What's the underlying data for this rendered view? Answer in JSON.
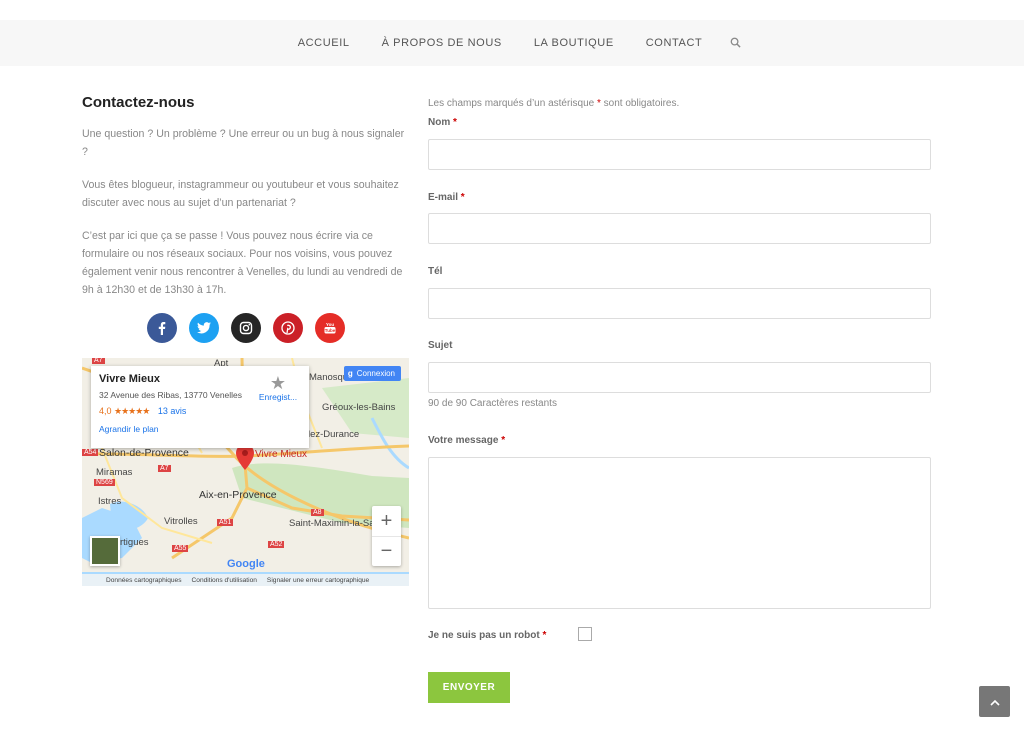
{
  "nav": {
    "items": [
      "ACCUEIL",
      "À PROPOS DE NOUS",
      "LA BOUTIQUE",
      "CONTACT"
    ],
    "search_icon": "search-icon"
  },
  "contact": {
    "title": "Contactez-nous",
    "p1": "Une question ? Un problème ? Une erreur ou un bug à nous signaler ?",
    "p2": "Vous êtes blogueur, instagrammeur ou youtubeur et vous souhaitez discuter avec nous au sujet d’un partenariat ?",
    "p3": "C’est par ici que ça se passe ! Vous pouvez nous écrire via ce formulaire ou nos réseaux sociaux. Pour nos voisins, vous pouvez également venir nous rencontrer à Venelles, du lundi au vendredi de 9h à 12h30 et de 13h30 à 17h."
  },
  "social": [
    {
      "name": "facebook-icon",
      "glyph": "f",
      "color": "#3b5998"
    },
    {
      "name": "twitter-icon",
      "glyph": "t",
      "color": "#1da1f2"
    },
    {
      "name": "instagram-icon",
      "glyph": "◎",
      "color": "#262626"
    },
    {
      "name": "pinterest-icon",
      "glyph": "P",
      "color": "#cb2027"
    },
    {
      "name": "youtube-icon",
      "glyph": "▶",
      "color": "#e52d27"
    }
  ],
  "map": {
    "place_name": "Vivre Mieux",
    "address": "32 Avenue des Ribas, 13770 Venelles",
    "rating": "4,0",
    "stars": "★★★★★",
    "reviews": "13 avis",
    "enlarge": "Agrandir le plan",
    "save": "Enregist...",
    "login": "Connexion",
    "login_g": "g",
    "pin_label": "Vivre Mieux",
    "towns": {
      "apt": "Apt",
      "manosque": "Manosque",
      "greoux": "Gréoux-les-Bains",
      "durance": "lez-Durance",
      "salon": "Salon-de-Provence",
      "miramas": "Miramas",
      "istres": "Istres",
      "aix": "Aix-en-Provence",
      "vitrolles": "Vitrolles",
      "stmax": "Saint-Maximin-la-Sai",
      "martigues": "rtigues"
    },
    "roads": {
      "a7a": "A7",
      "a7b": "A7",
      "a54": "A54",
      "n569": "N569",
      "a51": "A51",
      "a8": "A8",
      "a52": "A52",
      "a55": "A55"
    },
    "zoom_in": "+",
    "zoom_out": "−",
    "google": "Google",
    "attrib": [
      "Données cartographiques",
      "Conditions d'utilisation",
      "Signaler une erreur cartographique"
    ]
  },
  "form": {
    "note_pre": "Les champs marqués d’un astérisque",
    "note_ast": "*",
    "note_post": "sont obligatoires.",
    "nom": "Nom",
    "email": "E-mail",
    "tel": "Tél",
    "sujet": "Sujet",
    "counter": "90 de 90 Caractères restants",
    "message": "Votre message",
    "required": "*",
    "robot": "Je ne suis pas un robot",
    "submit": "ENVOYER"
  },
  "colors": {
    "accent": "#8cc63e",
    "required": "#cc0000"
  }
}
